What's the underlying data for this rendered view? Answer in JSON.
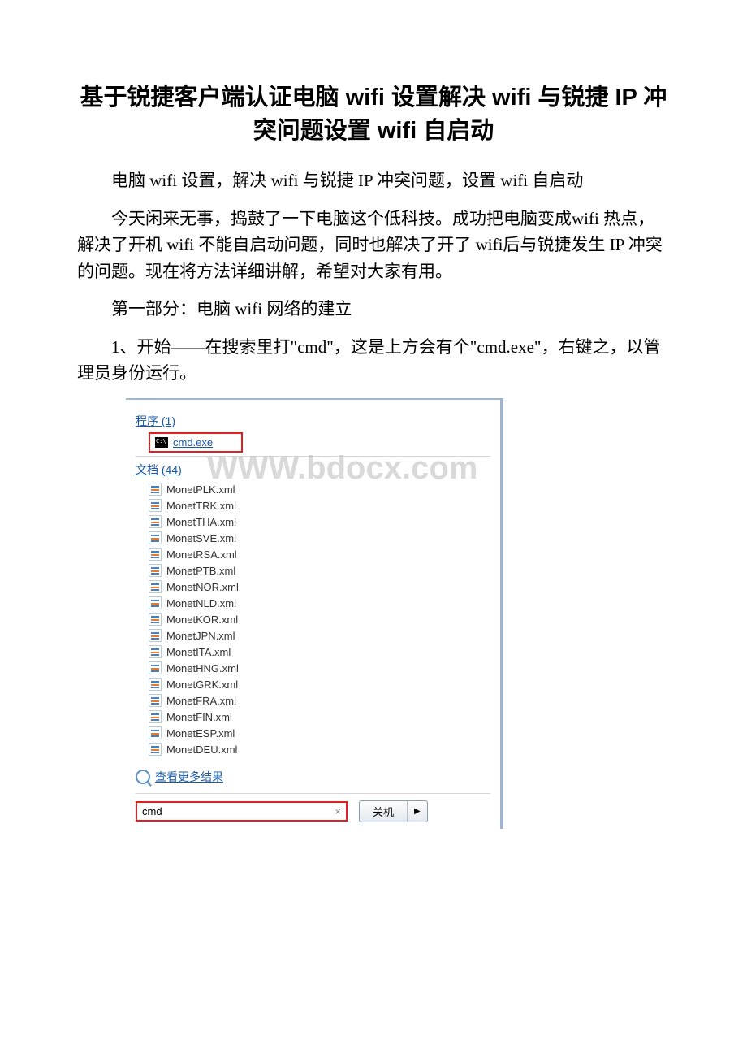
{
  "title": "基于锐捷客户端认证电脑 wifi 设置解决 wifi 与锐捷 IP 冲突问题设置 wifi 自启动",
  "intro": "电脑 wifi 设置，解决 wifi 与锐捷 IP 冲突问题，设置 wifi 自启动",
  "body1": "今天闲来无事，捣鼓了一下电脑这个低科技。成功把电脑变成wifi 热点，解决了开机 wifi 不能自启动问题，同时也解决了开了 wifi后与锐捷发生 IP 冲突的问题。现在将方法详细讲解，希望对大家有用。",
  "section": "第一部分：电脑 wifi 网络的建立",
  "step1": "1、开始——在搜索里打\"cmd\"，这是上方会有个\"cmd.exe\"，右键之，以管理员身份运行。",
  "watermark": "WWW.bdocx.com",
  "start_menu": {
    "programs_header": "程序 (1)",
    "cmd_label": "cmd.exe",
    "docs_header": "文档 (44)",
    "files": [
      "MonetPLK.xml",
      "MonetTRK.xml",
      "MonetTHA.xml",
      "MonetSVE.xml",
      "MonetRSA.xml",
      "MonetPTB.xml",
      "MonetNOR.xml",
      "MonetNLD.xml",
      "MonetKOR.xml",
      "MonetJPN.xml",
      "MonetITA.xml",
      "MonetHNG.xml",
      "MonetGRK.xml",
      "MonetFRA.xml",
      "MonetFIN.xml",
      "MonetESP.xml",
      "MonetDEU.xml"
    ],
    "more_results": "查看更多结果",
    "search_value": "cmd",
    "clear": "×",
    "shutdown": "关机",
    "arrow": "▶"
  }
}
